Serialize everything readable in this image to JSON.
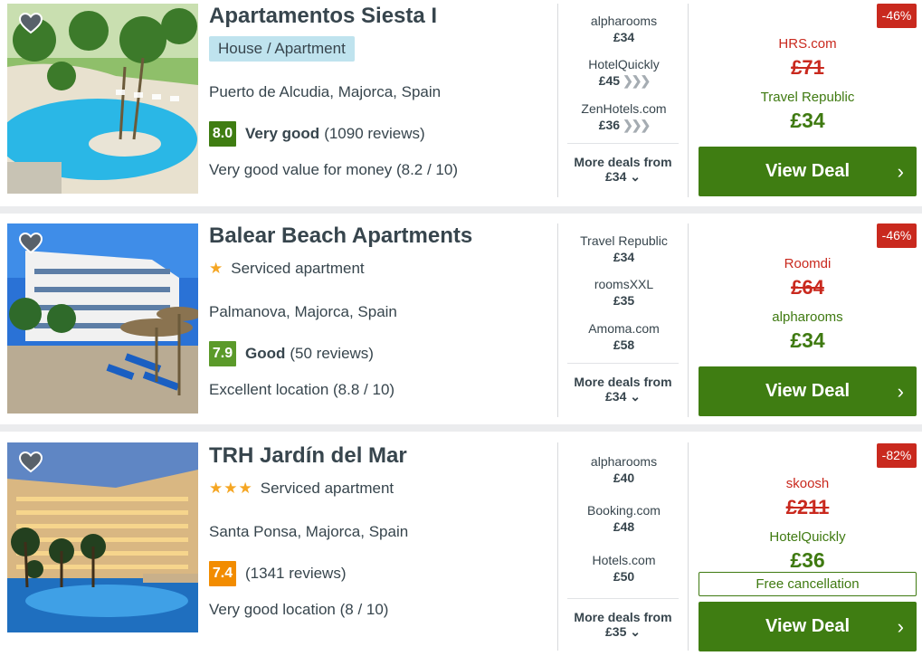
{
  "hotels": [
    {
      "name": "Apartamentos Siesta I",
      "type": "House / Apartment",
      "type_style": "badge",
      "stars": "",
      "location": "Puerto de Alcudia, Majorca, Spain",
      "score": "8.0",
      "score_color": "#3f7d12",
      "rating_label": "Very good",
      "reviews": "(1090 reviews)",
      "sub": "Very good value for money (8.2 / 10)",
      "deals": [
        {
          "provider": "alpharooms",
          "price": "£34",
          "arrows": ""
        },
        {
          "provider": "HotelQuickly",
          "price": "£45",
          "arrows": "❯❯❯"
        },
        {
          "provider": "ZenHotels.com",
          "price": "£36",
          "arrows": "❯❯❯"
        }
      ],
      "more_label": "More deals from",
      "more_price": "£34",
      "discount": "-46%",
      "old_provider": "HRS.com",
      "old_price": "£71",
      "best_provider": "Travel Republic",
      "best_price": "£34",
      "free_cancellation": "",
      "button": "View Deal"
    },
    {
      "name": "Balear Beach Apartments",
      "type": "Serviced apartment",
      "type_style": "line",
      "stars": "★",
      "location": "Palmanova, Majorca, Spain",
      "score": "7.9",
      "score_color": "#5b9a2a",
      "rating_label": "Good",
      "reviews": "(50 reviews)",
      "sub": "Excellent location (8.8 / 10)",
      "deals": [
        {
          "provider": "Travel Republic",
          "price": "£34",
          "arrows": ""
        },
        {
          "provider": "roomsXXL",
          "price": "£35",
          "arrows": ""
        },
        {
          "provider": "Amoma.com",
          "price": "£58",
          "arrows": ""
        }
      ],
      "more_label": "More deals from",
      "more_price": "£34",
      "discount": "-46%",
      "old_provider": "Roomdi",
      "old_price": "£64",
      "best_provider": "alpharooms",
      "best_price": "£34",
      "free_cancellation": "",
      "button": "View Deal"
    },
    {
      "name": "TRH Jardín del Mar",
      "type": "Serviced apartment",
      "type_style": "line",
      "stars": "★★★",
      "location": "Santa Ponsa, Majorca, Spain",
      "score": "7.4",
      "score_color": "#f28c00",
      "rating_label": "",
      "reviews": "(1341 reviews)",
      "sub": "Very good location (8 / 10)",
      "deals": [
        {
          "provider": "alpharooms",
          "price": "£40",
          "arrows": ""
        },
        {
          "provider": "Booking.com",
          "price": "£48",
          "arrows": ""
        },
        {
          "provider": "Hotels.com",
          "price": "£50",
          "arrows": ""
        }
      ],
      "more_label": "More deals from",
      "more_price": "£35",
      "discount": "-82%",
      "old_provider": "skoosh",
      "old_price": "£211",
      "best_provider": "HotelQuickly",
      "best_price": "£36",
      "free_cancellation": "Free cancellation",
      "button": "View Deal"
    }
  ]
}
